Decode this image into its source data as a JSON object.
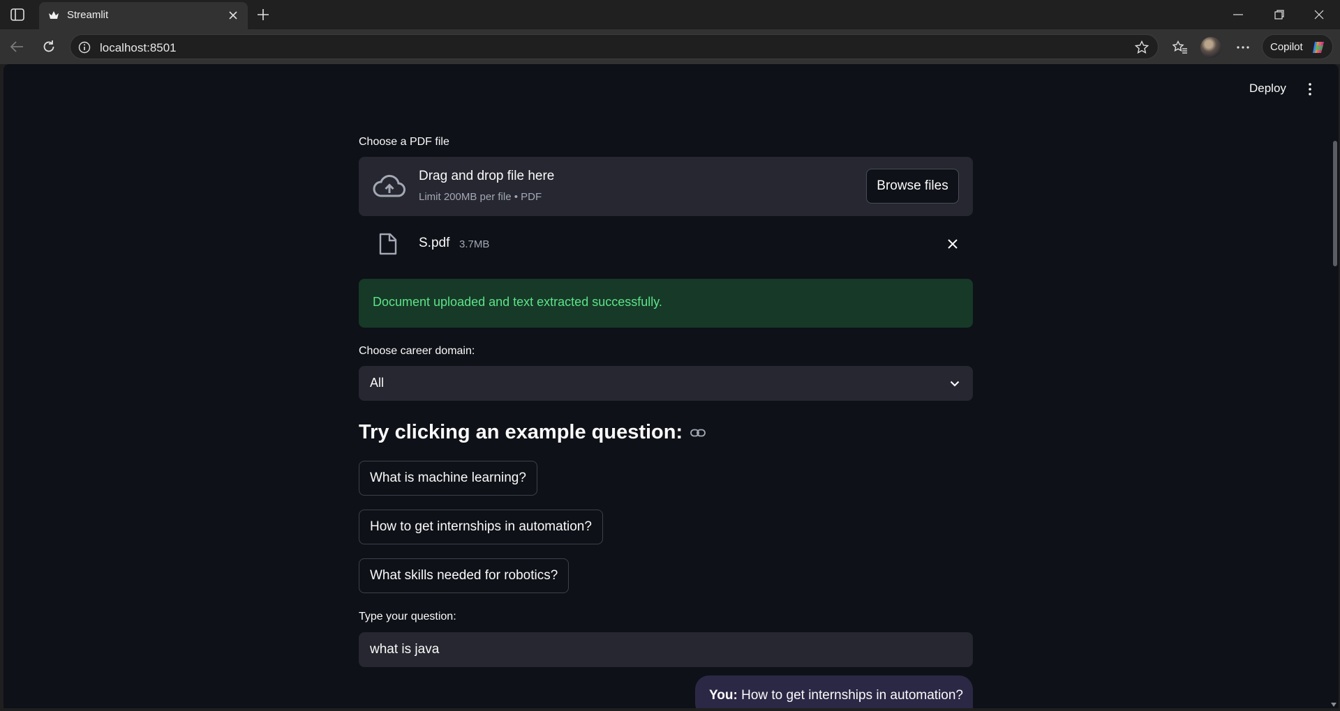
{
  "browser": {
    "tab_title": "Streamlit",
    "url": "localhost:8501",
    "copilot_label": "Copilot"
  },
  "app": {
    "deploy_label": "Deploy",
    "uploader": {
      "label": "Choose a PDF file",
      "title": "Drag and drop file here",
      "subtitle": "Limit 200MB per file • PDF",
      "browse_label": "Browse files"
    },
    "file": {
      "name": "S.pdf",
      "size": "3.7MB"
    },
    "success_message": "Document uploaded and text extracted successfully.",
    "domain_select": {
      "label": "Choose career domain:",
      "value": "All"
    },
    "examples_heading": "Try clicking an example question:",
    "examples": [
      "What is machine learning?",
      "How to get internships in automation?",
      "What skills needed for robotics?"
    ],
    "question_input": {
      "label": "Type your question:",
      "value": "what is java"
    },
    "chat": {
      "speaker": "You:",
      "message": "How to get internships in automation?"
    }
  }
}
